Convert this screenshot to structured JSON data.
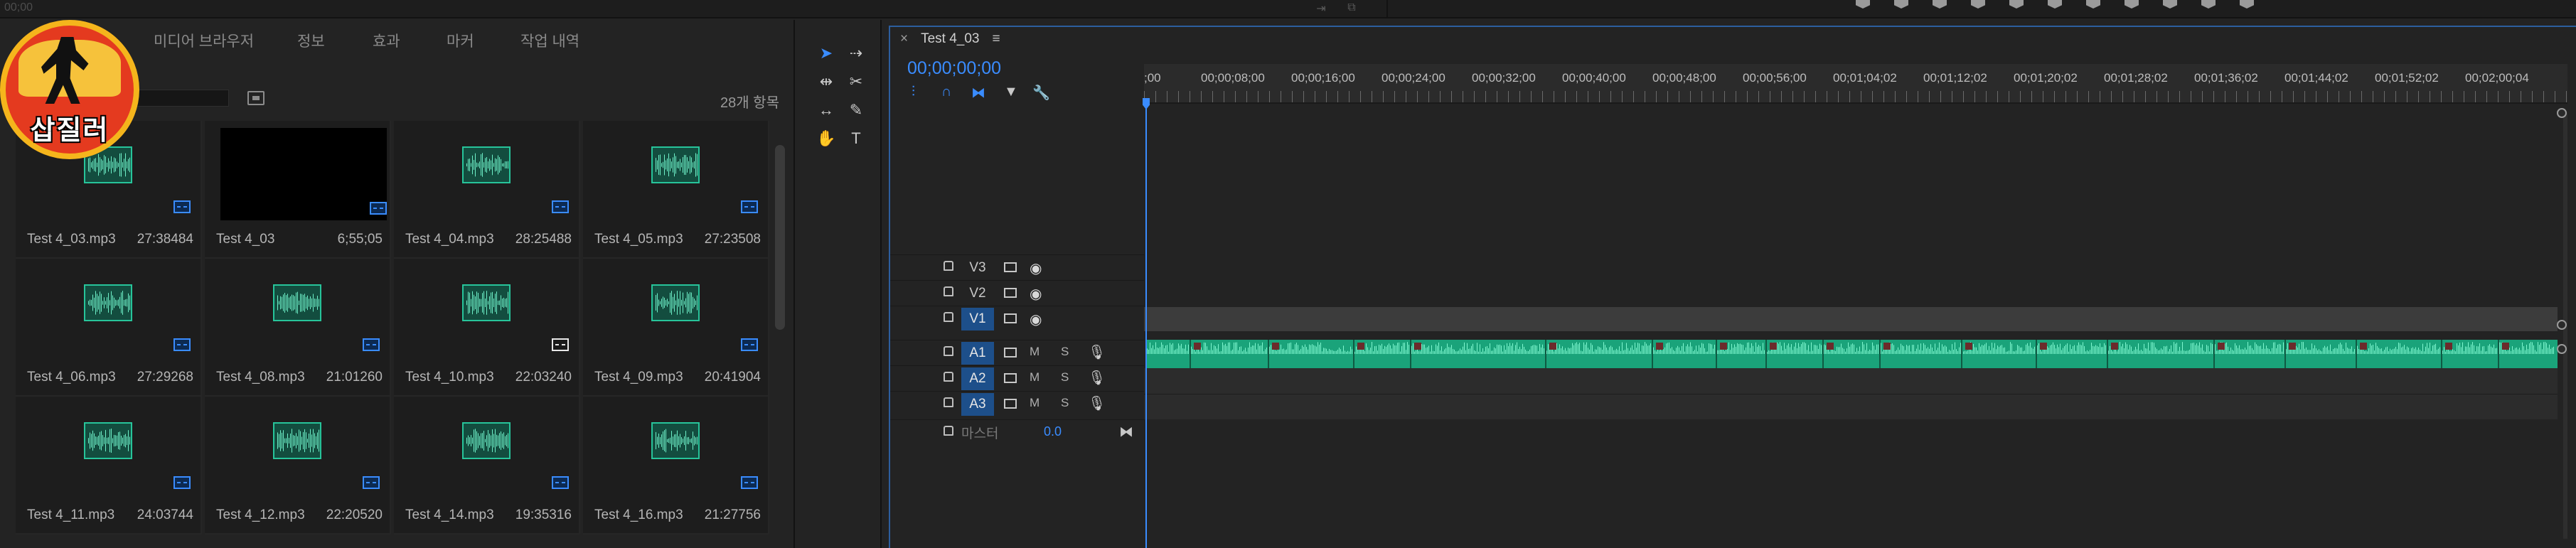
{
  "topbar": {
    "left_timecode": "00;00"
  },
  "logo": {
    "text": "삽질러"
  },
  "project": {
    "tabs": [
      "미디어 브라우저",
      "정보",
      "효과",
      "마커",
      "작업 내역"
    ],
    "item_count": "28개 항목",
    "items": [
      {
        "name": "Test 4_03.mp3",
        "duration": "27:38484",
        "kind": "audio"
      },
      {
        "name": "Test 4_03",
        "duration": "6;55;05",
        "kind": "sequence"
      },
      {
        "name": "Test 4_04.mp3",
        "duration": "28:25488",
        "kind": "audio"
      },
      {
        "name": "Test 4_05.mp3",
        "duration": "27:23508",
        "kind": "audio"
      },
      {
        "name": "Test 4_06.mp3",
        "duration": "27:29268",
        "kind": "audio"
      },
      {
        "name": "Test 4_08.mp3",
        "duration": "21:01260",
        "kind": "audio"
      },
      {
        "name": "Test 4_10.mp3",
        "duration": "22:03240",
        "kind": "audio"
      },
      {
        "name": "Test 4_09.mp3",
        "duration": "20:41904",
        "kind": "audio"
      },
      {
        "name": "Test 4_11.mp3",
        "duration": "24:03744",
        "kind": "audio"
      },
      {
        "name": "Test 4_12.mp3",
        "duration": "22:20520",
        "kind": "audio"
      },
      {
        "name": "Test 4_14.mp3",
        "duration": "19:35316",
        "kind": "audio"
      },
      {
        "name": "Test 4_16.mp3",
        "duration": "21:27756",
        "kind": "audio"
      }
    ]
  },
  "timeline": {
    "sequence_tab": "Test 4_03",
    "close_glyph": "×",
    "menu_glyph": "≡",
    "timecode": "00;00;00;00",
    "ruler_ticks": [
      ";00",
      "00;00;08;00",
      "00;00;16;00",
      "00;00;24;00",
      "00;00;32;00",
      "00;00;40;00",
      "00;00;48;00",
      "00;00;56;00",
      "00;01;04;02",
      "00;01;12;02",
      "00;01;20;02",
      "00;01;28;02",
      "00;01;36;02",
      "00;01;44;02",
      "00;01;52;02",
      "00;02;00;04"
    ],
    "video_tracks": [
      "V3",
      "V2",
      "V1"
    ],
    "audio_tracks": [
      "A1",
      "A2",
      "A3"
    ],
    "mute_label": "M",
    "solo_label": "S",
    "master_label": "마스터",
    "master_volume": "0.0",
    "accent_color": "#3a8cff",
    "clip_color": "#1aa37a"
  }
}
